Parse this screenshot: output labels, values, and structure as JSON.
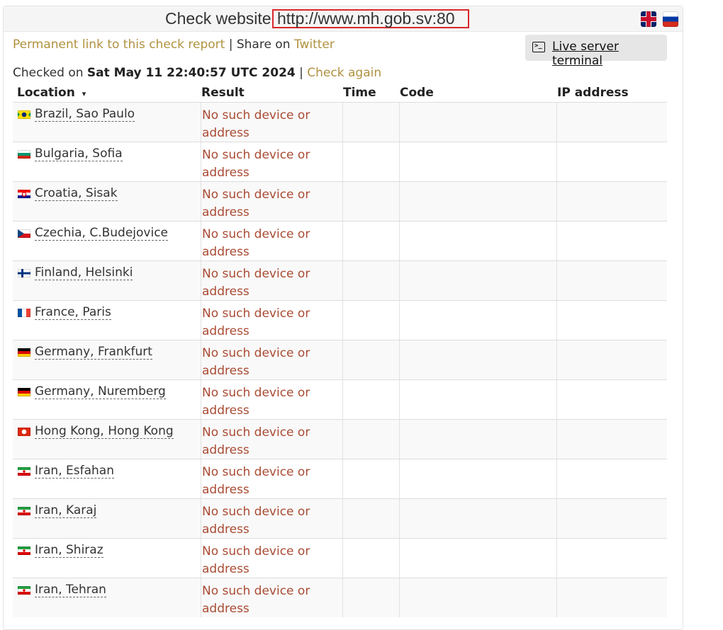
{
  "header": {
    "title_label": "Check website",
    "url": "http://www.mh.gob.sv:80",
    "lang_flags": [
      "uk-flag-icon",
      "ru-flag-icon"
    ]
  },
  "links": {
    "permalink": "Permanent link to this check report",
    "separator": " | Share on ",
    "twitter": "Twitter"
  },
  "terminal": {
    "label": "Live server terminal",
    "icon": "terminal-icon"
  },
  "checked": {
    "prefix": "Checked on ",
    "datetime": "Sat May 11 22:40:57 UTC 2024",
    "separator": " | ",
    "again": "Check again"
  },
  "table": {
    "headers": {
      "location": "Location",
      "sort_arrow": "▾",
      "result": "Result",
      "time": "Time",
      "code": "Code",
      "ip": "IP address"
    },
    "rows": [
      {
        "flag": "br",
        "location": "Brazil, Sao Paulo",
        "result": "No such device or address"
      },
      {
        "flag": "bg",
        "location": "Bulgaria, Sofia",
        "result": "No such device or address"
      },
      {
        "flag": "hr",
        "location": "Croatia, Sisak",
        "result": "No such device or address"
      },
      {
        "flag": "cz",
        "location": "Czechia, C.Budejovice",
        "result": "No such device or address"
      },
      {
        "flag": "fi",
        "location": "Finland, Helsinki",
        "result": "No such device or address"
      },
      {
        "flag": "fr",
        "location": "France, Paris",
        "result": "No such device or address"
      },
      {
        "flag": "de",
        "location": "Germany, Frankfurt",
        "result": "No such device or address"
      },
      {
        "flag": "de",
        "location": "Germany, Nuremberg",
        "result": "No such device or address"
      },
      {
        "flag": "hk",
        "location": "Hong Kong, Hong Kong",
        "result": "No such device or address"
      },
      {
        "flag": "ir",
        "location": "Iran, Esfahan",
        "result": "No such device or address"
      },
      {
        "flag": "ir",
        "location": "Iran, Karaj",
        "result": "No such device or address"
      },
      {
        "flag": "ir",
        "location": "Iran, Shiraz",
        "result": "No such device or address"
      },
      {
        "flag": "ir",
        "location": "Iran, Tehran",
        "result": "No such device or address"
      }
    ]
  },
  "colors": {
    "link": "#b0913f",
    "error": "#a94b33",
    "highlight_box": "#d9262b"
  }
}
